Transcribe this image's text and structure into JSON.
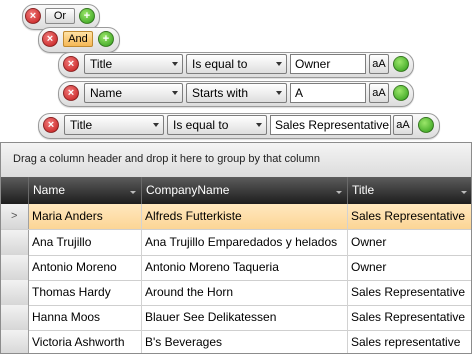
{
  "filter": {
    "root": {
      "operator": "Or",
      "remove_icon": "x-icon",
      "add_icon": "plus-icon"
    },
    "group": {
      "operator": "And",
      "remove_icon": "x-icon",
      "add_icon": "plus-icon"
    },
    "conditions": [
      {
        "member": "Title",
        "operator": "Is equal to",
        "value": "Owner",
        "case_label": "aA"
      },
      {
        "member": "Name",
        "operator": "Starts with",
        "value": "A",
        "case_label": "aA"
      },
      {
        "member": "Title",
        "operator": "Is equal to",
        "value": "Sales Representative",
        "case_label": "aA"
      }
    ]
  },
  "grid": {
    "group_panel_text": "Drag a column header and drop it here to group by that column",
    "columns": [
      "Name",
      "CompanyName",
      "Title"
    ],
    "selected_row_indicator": ">",
    "rows": [
      {
        "name": "Maria Anders",
        "company": "Alfreds Futterkiste",
        "title": "Sales Representative"
      },
      {
        "name": "Ana Trujillo",
        "company": "Ana Trujillo Emparedados y helados",
        "title": "Owner"
      },
      {
        "name": "Antonio Moreno",
        "company": "Antonio Moreno Taqueria",
        "title": "Owner"
      },
      {
        "name": "Thomas Hardy",
        "company": "Around the Horn",
        "title": "Sales Representative"
      },
      {
        "name": "Hanna Moos",
        "company": "Blauer See Delikatessen",
        "title": "Sales Representative"
      },
      {
        "name": "Victoria Ashworth",
        "company": "B's Beverages",
        "title": "Sales representative"
      }
    ]
  },
  "colors": {
    "selected_row": "#fcd595",
    "header_bg": "#1d1d1d",
    "remove_red": "#c41919",
    "add_green": "#2e9c18"
  }
}
